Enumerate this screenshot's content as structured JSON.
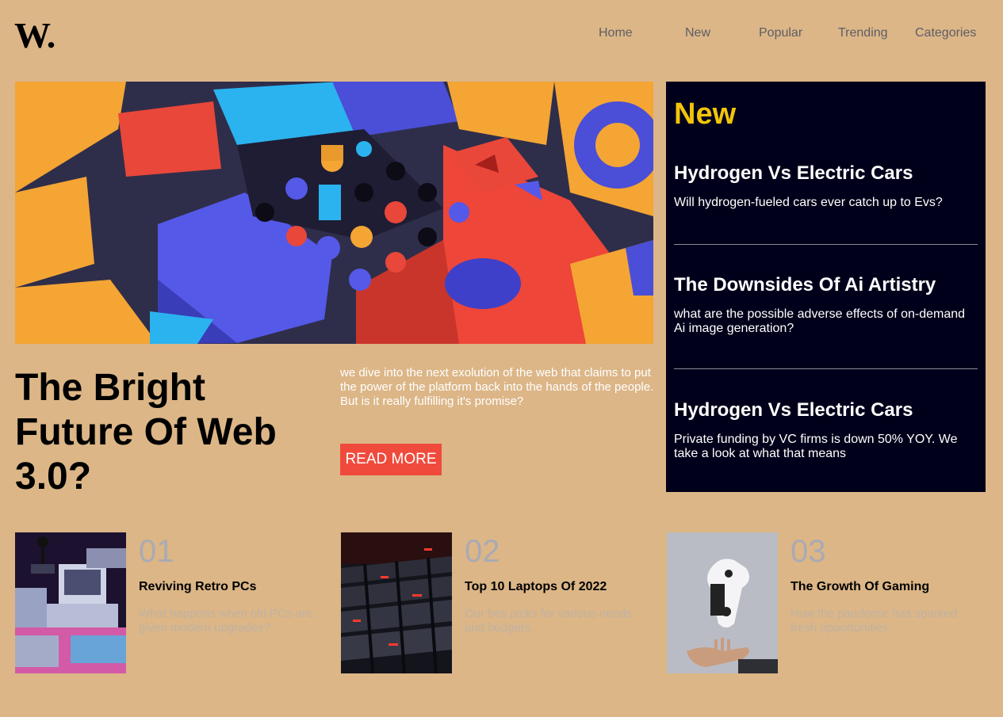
{
  "logo": "W.",
  "nav": {
    "items": [
      "Home",
      "New",
      "Popular",
      "Trending",
      "Categories"
    ]
  },
  "hero": {
    "image": "colorful-3d-blocks-image",
    "title": "The Bright Future Of Web 3.0?",
    "description": "we dive into the next exolution of the web that claims to put the power of the platform back into the hands of the people. But is it really fulfilling it's promise?",
    "cta": "READ MORE"
  },
  "new_panel": {
    "heading": "New",
    "items": [
      {
        "title": "Hydrogen Vs Electric Cars",
        "text": "Will hydrogen-fueled cars ever catch up to Evs?"
      },
      {
        "title": "The Downsides Of Ai Artistry",
        "text": "what are the possible adverse effects of on-demand Ai image generation?"
      },
      {
        "title": "Hydrogen Vs Electric Cars",
        "text": "Private funding by VC firms is down 50% YOY. We take a look at what that means"
      }
    ]
  },
  "articles": [
    {
      "number": "01",
      "title": "Reviving Retro PCs",
      "text": "What happens when old PCs are given modern upgrades?",
      "image": "retro-pc-image"
    },
    {
      "number": "02",
      "title": "Top 10 Laptops Of 2022",
      "text": "Our bes picks for various needs and budgets.",
      "image": "laptop-keyboard-image"
    },
    {
      "number": "03",
      "title": "The Growth Of Gaming",
      "text": "How the pandemic has sparked fresh opportunities",
      "image": "game-controller-image"
    }
  ],
  "colors": {
    "background": "#dcb687",
    "panel": "#00001a",
    "accent": "#f2c40a",
    "cta": "#f04a3c",
    "number": "#a9aab4"
  }
}
